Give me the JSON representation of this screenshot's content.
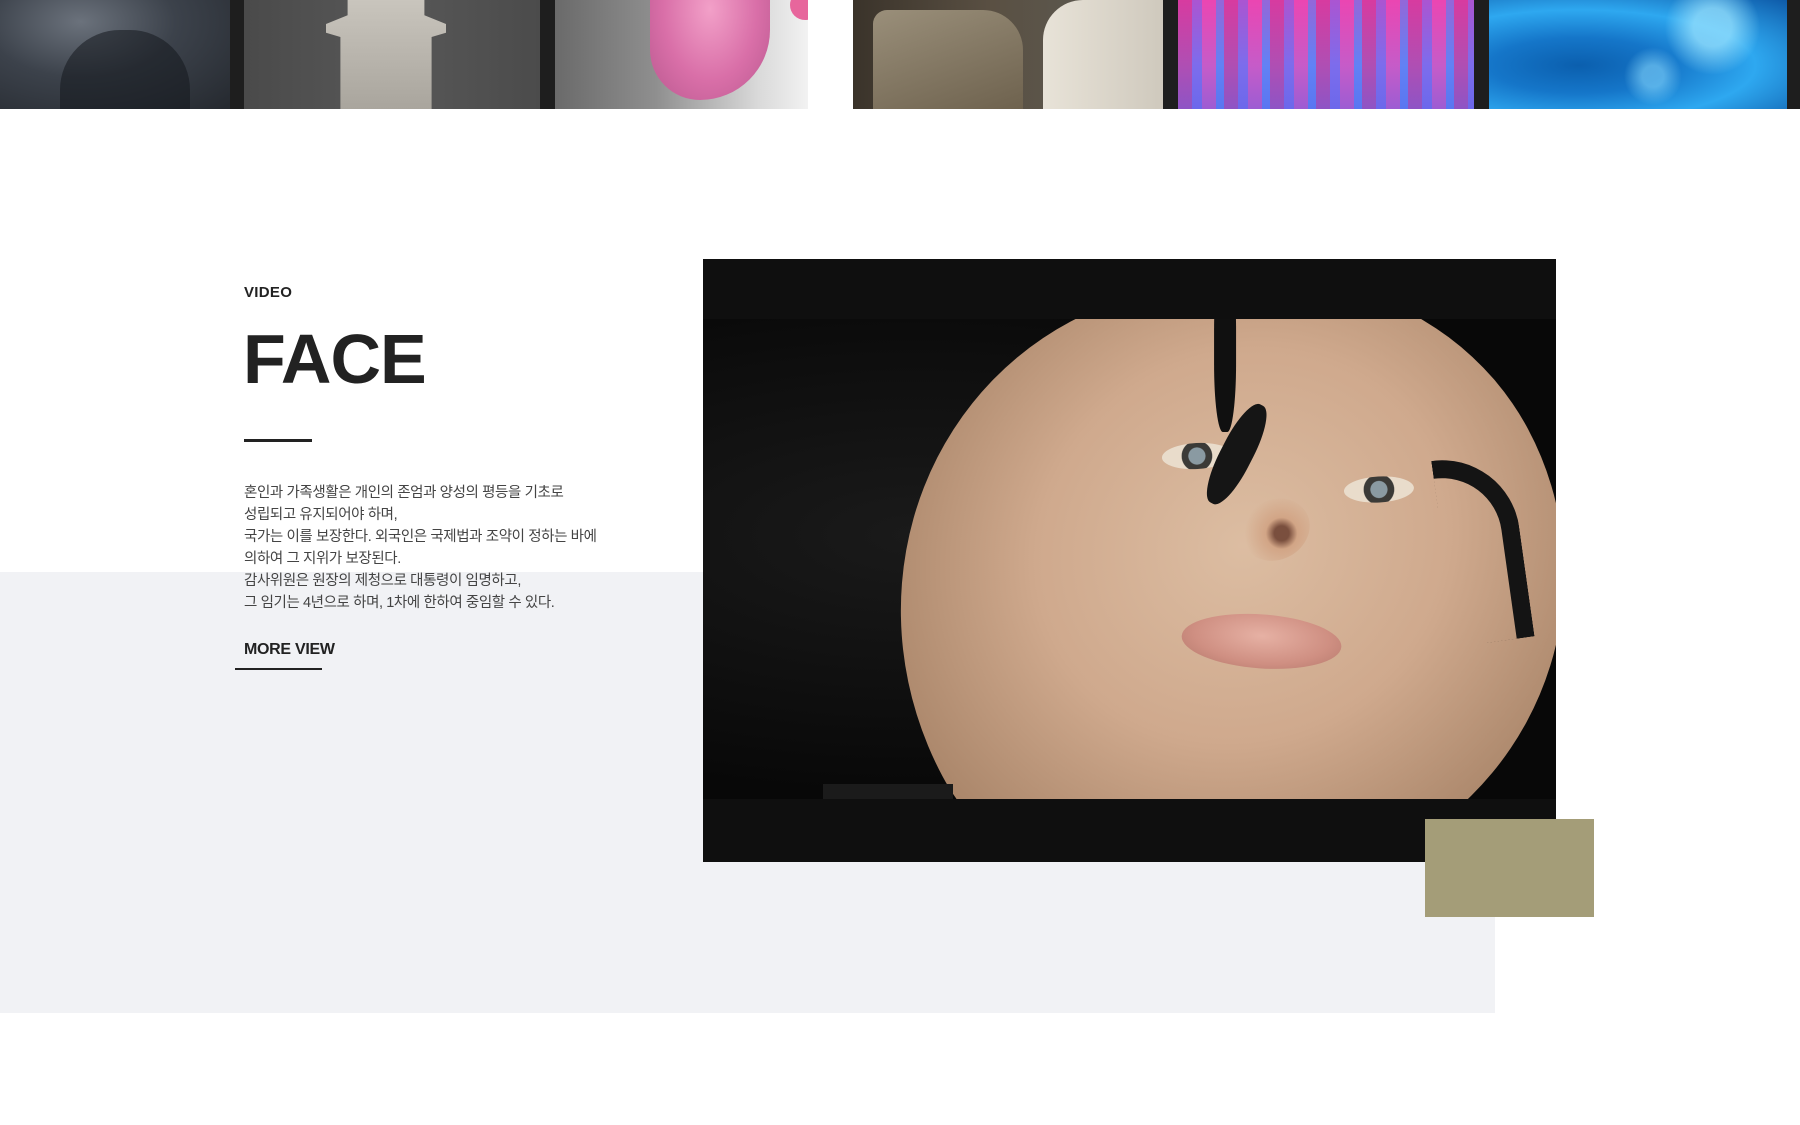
{
  "gallery": {
    "thumbnails": [
      {
        "name": "dark-portrait"
      },
      {
        "name": "plaster-pedestal"
      },
      {
        "name": "pink-hair"
      },
      {
        "name": "sculpture-studio"
      },
      {
        "name": "magenta-abstract"
      },
      {
        "name": "blue-abstract"
      }
    ]
  },
  "feature": {
    "eyebrow": "VIDEO",
    "title": "FACE",
    "description": [
      "혼인과 가족생활은 개인의 존엄과 양성의 평등을 기초로",
      "성립되고 유지되어야 하며,",
      "국가는 이를 보장한다. 외국인은 국제법과 조약이 정하는 바에",
      "의하여 그 지위가 보장된다.",
      "감사위원은 원장의 제청으로 대통령이 임명하고,",
      "그 임기는 4년으로 하며, 1차에 한하여 중임할 수 있다."
    ],
    "more_label": "MORE VIEW"
  },
  "colors": {
    "accent_block": "#a49d78",
    "panel_grey": "#f1f2f5",
    "text_dark": "#222222",
    "video_bg": "#0f0f0f"
  }
}
